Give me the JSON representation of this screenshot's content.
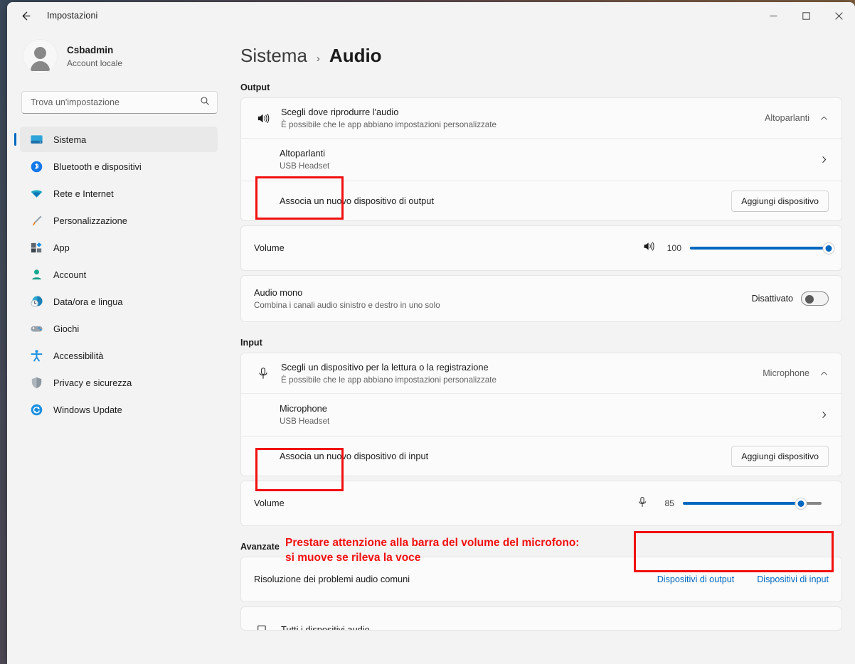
{
  "window": {
    "title": "Impostazioni",
    "back_icon": "arrow-left-icon",
    "minimize_label": "—",
    "maximize_label": "□",
    "close_label": "✕"
  },
  "account": {
    "name": "Csbadmin",
    "subtitle": "Account locale",
    "avatar_icon": "user-avatar-icon"
  },
  "search": {
    "placeholder": "Trova un'impostazione",
    "value": "",
    "icon": "search-icon"
  },
  "sidebar": {
    "items": [
      {
        "label": "Sistema",
        "icon": "monitor-icon",
        "active": true
      },
      {
        "label": "Bluetooth e dispositivi",
        "icon": "bluetooth-icon",
        "active": false
      },
      {
        "label": "Rete e Internet",
        "icon": "wifi-icon",
        "active": false
      },
      {
        "label": "Personalizzazione",
        "icon": "paintbrush-icon",
        "active": false
      },
      {
        "label": "App",
        "icon": "apps-icon",
        "active": false
      },
      {
        "label": "Account",
        "icon": "person-icon",
        "active": false
      },
      {
        "label": "Data/ora e lingua",
        "icon": "clock-globe-icon",
        "active": false
      },
      {
        "label": "Giochi",
        "icon": "gamepad-icon",
        "active": false
      },
      {
        "label": "Accessibilità",
        "icon": "accessibility-icon",
        "active": false
      },
      {
        "label": "Privacy e sicurezza",
        "icon": "shield-icon",
        "active": false
      },
      {
        "label": "Windows Update",
        "icon": "update-icon",
        "active": false
      }
    ]
  },
  "breadcrumb": {
    "root": "Sistema",
    "separator": "›",
    "current": "Audio"
  },
  "output": {
    "section_label": "Output",
    "chooser": {
      "icon": "speaker-icon",
      "title": "Scegli dove riprodurre l'audio",
      "subtitle": "È possibile che le app abbiano impostazioni personalizzate",
      "value": "Altoparlanti",
      "chevron": "chevron-up-icon"
    },
    "device": {
      "name": "Altoparlanti",
      "subtitle": "USB Headset",
      "chevron": "chevron-right-icon"
    },
    "pair": {
      "title": "Associa un nuovo dispositivo di output",
      "button": "Aggiungi dispositivo"
    },
    "volume": {
      "title": "Volume",
      "icon": "speaker-icon",
      "value": "100",
      "percent": 100
    },
    "mono": {
      "title": "Audio mono",
      "subtitle": "Combina i canali audio sinistro e destro in uno solo",
      "state_label": "Disattivato",
      "on": false
    }
  },
  "input": {
    "section_label": "Input",
    "chooser": {
      "icon": "microphone-icon",
      "title": "Scegli un dispositivo per la lettura o la registrazione",
      "subtitle": "È possibile che le app abbiano impostazioni personalizzate",
      "value": "Microphone",
      "chevron": "chevron-up-icon"
    },
    "device": {
      "name": "Microphone",
      "subtitle": "USB Headset",
      "chevron": "chevron-right-icon"
    },
    "pair": {
      "title": "Associa un nuovo dispositivo di input",
      "button": "Aggiungi dispositivo"
    },
    "volume": {
      "title": "Volume",
      "icon": "microphone-icon",
      "value": "85",
      "percent": 85
    }
  },
  "advanced": {
    "section_label": "Avanzate",
    "troubleshoot": {
      "title": "Risoluzione dei problemi audio comuni",
      "link_output": "Dispositivi di output",
      "link_input": "Dispositivi di input"
    },
    "all_devices": {
      "title": "Tutti i dispositivi audio",
      "icon": "devices-icon"
    }
  },
  "annotation": {
    "color": "#f20f0f",
    "mic_volume_note": "Prestare attenzione alla barra del volume del microfono:\nsi muove se rileva la voce"
  }
}
